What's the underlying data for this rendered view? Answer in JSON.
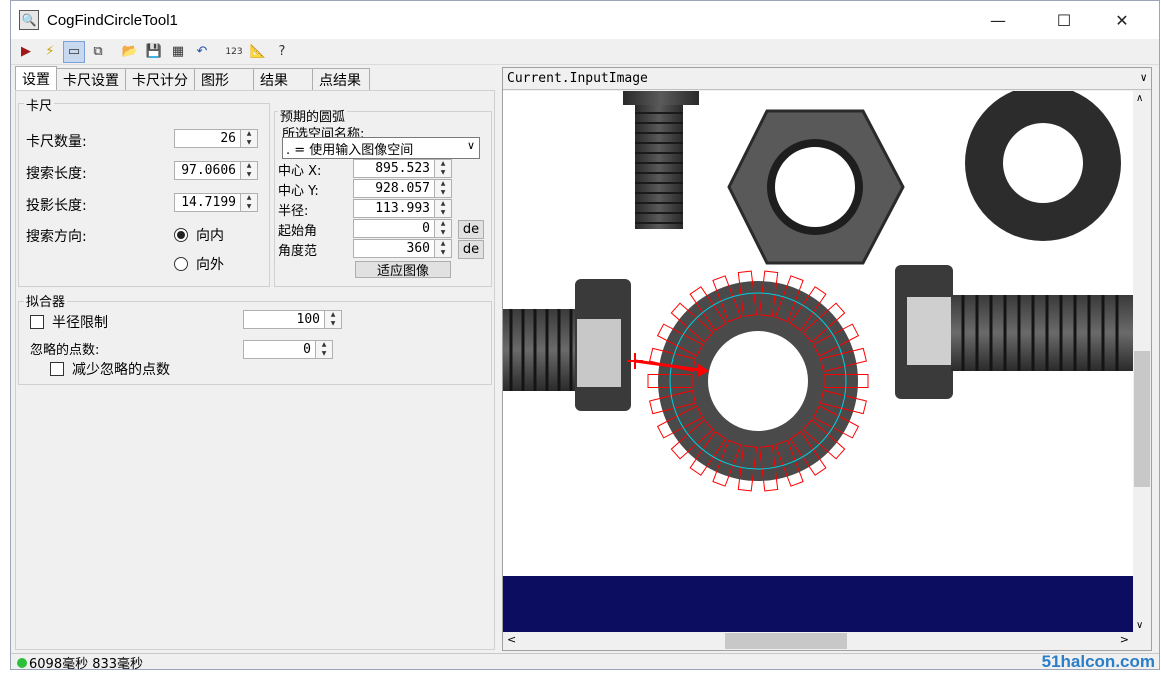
{
  "window": {
    "title": "CogFindCircleTool1"
  },
  "tabs": [
    "设置",
    "卡尺设置",
    "卡尺计分",
    "图形",
    "结果",
    "点结果"
  ],
  "caliper": {
    "group_title": "卡尺",
    "count_label": "卡尺数量:",
    "count_value": "26",
    "search_len_label": "搜索长度:",
    "search_len_value": "97.0606",
    "proj_len_label": "投影长度:",
    "proj_len_value": "14.7199",
    "direction_label": "搜索方向:",
    "dir_inward": "向内",
    "dir_outward": "向外"
  },
  "arc": {
    "group_title": "预期的圆弧",
    "space_label": "所选空间名称:",
    "space_value": ". = 使用输入图像空间",
    "center_x_label": "中心 X:",
    "center_x": "895.523",
    "center_y_label": "中心 Y:",
    "center_y": "928.057",
    "radius_label": "半径:",
    "radius": "113.993",
    "start_label": "起始角",
    "start_value": "0",
    "span_label": "角度范",
    "span_value": "360",
    "unit_btn": "de",
    "fit_btn": "适应图像"
  },
  "fitter": {
    "group_title": "拟合器",
    "radius_limit_label": "半径限制",
    "radius_limit_value": "100",
    "ignore_label": "忽略的点数:",
    "ignore_value": "0",
    "reduce_label": "减少忽略的点数"
  },
  "image": {
    "header": "Current.InputImage"
  },
  "status": {
    "text": "6098毫秒 833毫秒"
  },
  "watermark": "51halcon.com",
  "icons": [
    "run-icon",
    "lightning-icon",
    "view-icon",
    "copy-icon",
    "open-icon",
    "save-icon",
    "grid-icon",
    "reset-icon",
    "number-icon",
    "ruler-icon",
    "help-icon"
  ]
}
